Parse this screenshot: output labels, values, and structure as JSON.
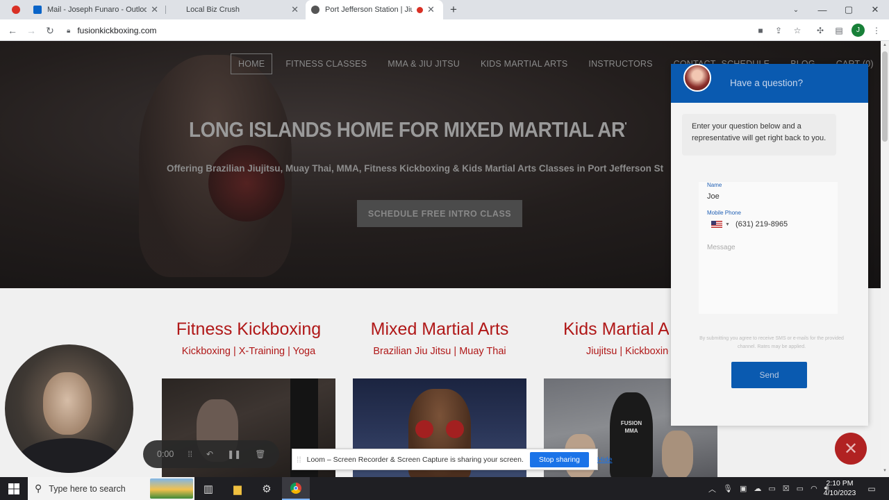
{
  "browser": {
    "tabs": [
      {
        "title": "Mail - Joseph Funaro - Outlook",
        "active": false
      },
      {
        "title": "Local Biz Crush",
        "active": false
      },
      {
        "title": "Port Jefferson Station | Jiujits",
        "active": true
      }
    ],
    "new_tab": "+",
    "url": "fusionkickboxing.com",
    "profile_initial": "J"
  },
  "site": {
    "nav": [
      "HOME",
      "FITNESS CLASSES",
      "MMA & JIU JITSU",
      "KIDS MARTIAL ARTS",
      "INSTRUCTORS",
      "CONTACT",
      "SCHEDULE",
      "BLOG",
      "CART (0)"
    ],
    "hero_title": "LONG ISLANDS HOME FOR MIXED MARTIAL ARTS AND KICKBOXI",
    "hero_subtitle": "Offering Brazilian Jiujitsu, Muay Thai, MMA, Fitness Kickboxing  & Kids Martial Arts Classes in Port Jefferson St",
    "cta": "SCHEDULE FREE INTRO CLASS",
    "programs": [
      {
        "title": "Fitness Kickboxing",
        "subtitle": "Kickboxing | X-Training | Yoga"
      },
      {
        "title": "Mixed Martial Arts",
        "subtitle": "Brazilian Jiu Jitsu | Muay Thai"
      },
      {
        "title": "Kids Martial A",
        "subtitle": "Jiujitsu | Kickboxing"
      }
    ],
    "program_image_labels": [
      "FUSION",
      "MMA"
    ]
  },
  "chat": {
    "header": "Have a question?",
    "bubble": "Enter your question below and a representative will get right back to you.",
    "name_label": "Name",
    "name_value": "Joe",
    "phone_label": "Mobile Phone",
    "phone_value": "(631) 219-8965",
    "message_placeholder": "Message",
    "consent": "By submitting you agree to receive SMS or e-mails for the provided channel. Rates may be applied.",
    "send": "Send"
  },
  "loom": {
    "timer": "0:00",
    "share_message": "Loom – Screen Recorder & Screen Capture is sharing your screen.",
    "stop": "Stop sharing",
    "hide": "Hide"
  },
  "taskbar": {
    "search_placeholder": "Type here to search",
    "time": "2:10 PM",
    "date": "4/10/2023"
  },
  "colors": {
    "accent_red": "#b01818",
    "chat_blue": "#0a5ab0",
    "link_blue": "#1a73e8"
  }
}
